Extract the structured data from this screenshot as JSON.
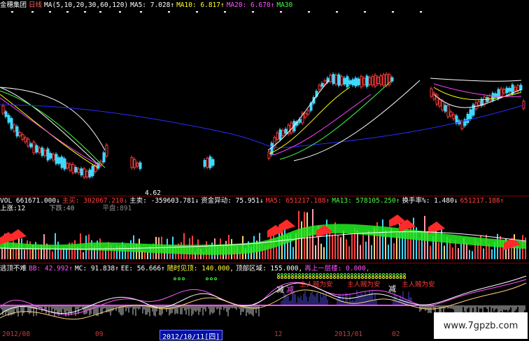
{
  "header": {
    "stock_name": "金穗集团",
    "period": "日线",
    "ma_params": "MA(5,10,20,30,60,120)",
    "ma5": "MA5: 7.028↑",
    "ma10": "MA10: 6.817↑",
    "ma20": "MA20: 6.670↑",
    "ma30": "MA30"
  },
  "price_panel": {
    "low_marker": "4.62"
  },
  "vol_panel": {
    "vol": "VOL 661671.000↓",
    "main_buy": "主买: 302067.210↓",
    "main_sell": "主卖: -359603.781↓",
    "capital_flow": "资金异动: 75.951↓",
    "ma5": "MA5: 651217.188↑",
    "ma13": "MA13: 578105.250↑",
    "turnover": "换手率%: 1.480↓",
    "extra": "651217.188↑",
    "up": "上涨:12",
    "down": "下跌:40",
    "flat": "平盘:891"
  },
  "ind_panel": {
    "name": "逃顶不难",
    "bb": "BB: 42.992↑",
    "mc": "MC: 91.838↑",
    "ee": "EE: 56.666↑",
    "timely": "随时见顶: 140.000,",
    "top_zone": "顶部区域: 155.000,",
    "step_up": "再上一层楼: 0.000,",
    "label_reduce_1": "减",
    "label_reduce_2": "减",
    "label_reduce_3": "减",
    "label_safe_1": "主人贼为安",
    "label_safe_2": "主人贼为安",
    "label_safe_3": "主人贼为安"
  },
  "dates": {
    "d1": "2012/08",
    "d2": "09",
    "d3_selected": "2012/10/11[四]",
    "d4": "12",
    "d5": "2013/01",
    "d6": "02"
  },
  "watermark": "www.7gpzb.com",
  "colors": {
    "up": "#ff3b3b",
    "down": "#3fd8ff",
    "ma5": "#ffffff",
    "ma10": "#ffff00",
    "ma20": "#ff44ff",
    "ma30": "#44ff44",
    "ma60": "#2a2aff"
  }
}
